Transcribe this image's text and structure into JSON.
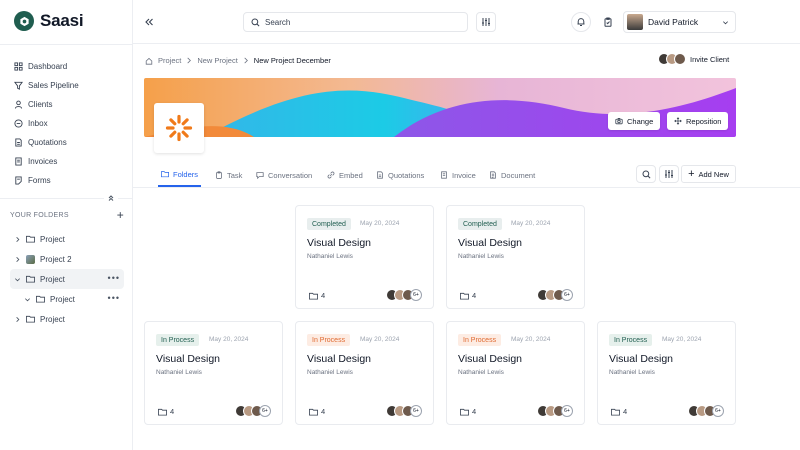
{
  "app": {
    "name": "Saasi"
  },
  "sidebar": {
    "nav": [
      {
        "label": "Dashboard",
        "icon": "dashboard-icon"
      },
      {
        "label": "Sales Pipeline",
        "icon": "funnel-icon"
      },
      {
        "label": "Clients",
        "icon": "user-icon"
      },
      {
        "label": "Inbox",
        "icon": "message-icon"
      },
      {
        "label": "Quotations",
        "icon": "document-icon"
      },
      {
        "label": "Invoices",
        "icon": "invoice-icon"
      },
      {
        "label": "Forms",
        "icon": "form-icon"
      }
    ],
    "folders_title": "YOUR FOLDERS",
    "folders": [
      {
        "label": "Project"
      },
      {
        "label": "Project 2"
      },
      {
        "label": "Project"
      },
      {
        "label": "Project"
      },
      {
        "label": "Project"
      }
    ]
  },
  "topbar": {
    "search_placeholder": "Search",
    "user_name": "David Patrick"
  },
  "breadcrumb": {
    "items": [
      "Project",
      "New Project",
      "New Project December"
    ]
  },
  "invite_label": "Invite Client",
  "banner": {
    "change_label": "Change",
    "reposition_label": "Reposition"
  },
  "tabs": [
    {
      "label": "Folders"
    },
    {
      "label": "Task"
    },
    {
      "label": "Conversation"
    },
    {
      "label": "Embed"
    },
    {
      "label": "Quotations"
    },
    {
      "label": "Invoice"
    },
    {
      "label": "Document"
    }
  ],
  "add_new_label": "Add New",
  "cards": [
    {
      "status": "Completed",
      "date": "May 20, 2024",
      "title": "Visual Design",
      "owner": "Nathaniel Lewis",
      "count": "4",
      "more": "6+"
    },
    {
      "status": "Completed",
      "date": "May 20, 2024",
      "title": "Visual Design",
      "owner": "Nathaniel Lewis",
      "count": "4",
      "more": "6+"
    },
    {
      "status": "In Process",
      "date": "May 20, 2024",
      "title": "Visual Design",
      "owner": "Nathaniel Lewis",
      "count": "4",
      "more": "6+"
    },
    {
      "status": "In Process",
      "date": "May 20, 2024",
      "title": "Visual Design",
      "owner": "Nathaniel Lewis",
      "count": "4",
      "more": "6+"
    },
    {
      "status": "In Process",
      "date": "May 20, 2024",
      "title": "Visual Design",
      "owner": "Nathaniel Lewis",
      "count": "4",
      "more": "6+"
    },
    {
      "status": "In Process",
      "date": "May 20, 2024",
      "title": "Visual Design",
      "owner": "Nathaniel Lewis",
      "count": "4",
      "more": "6+"
    }
  ],
  "colors": {
    "brand": "#1f5d4f",
    "accent": "#2563eb",
    "in_process_orange": "#e0692f"
  }
}
